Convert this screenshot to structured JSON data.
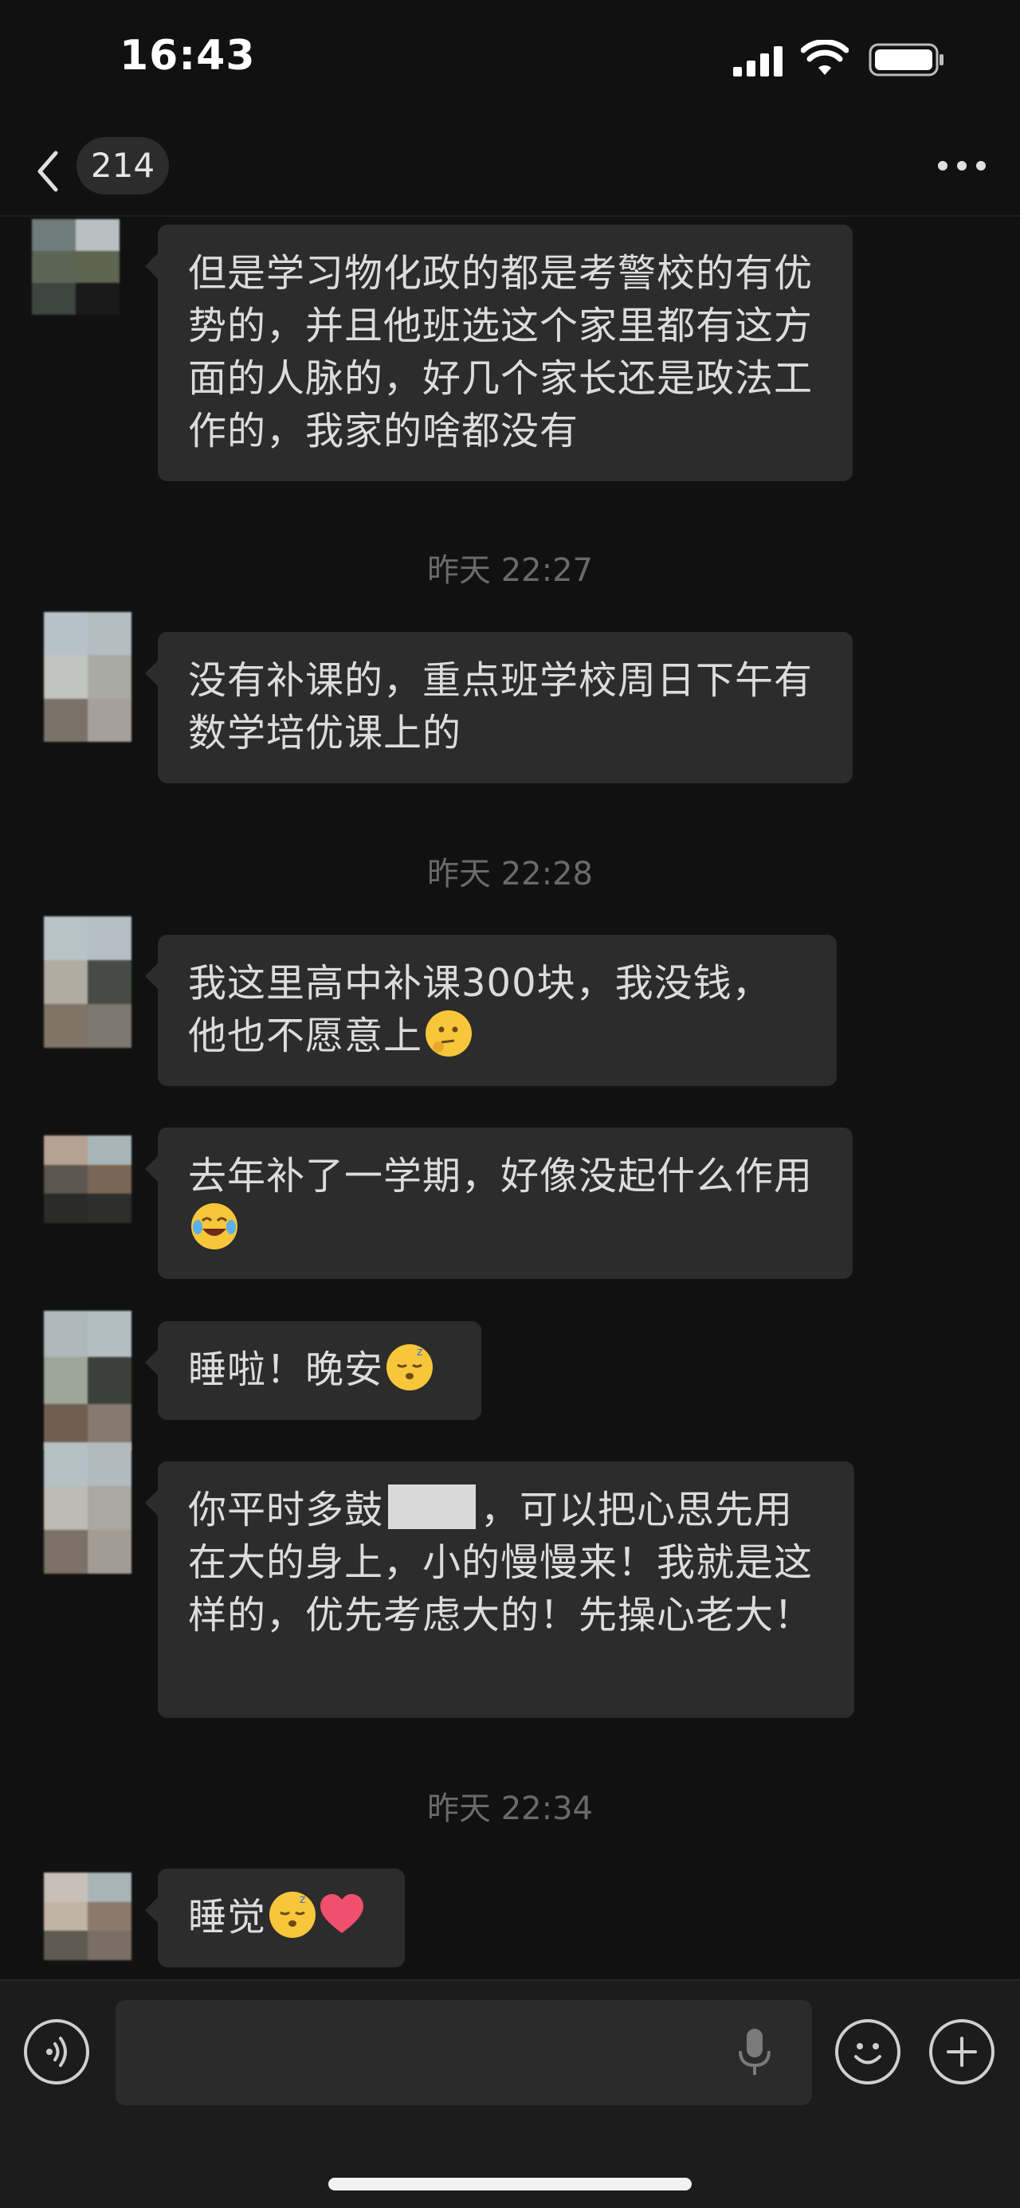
{
  "status_bar": {
    "time": "16:43",
    "signal": "signal-bars-icon",
    "wifi": "wifi-icon",
    "battery": "battery-icon"
  },
  "nav": {
    "unread_count": "214",
    "back_icon": "chevron-left-icon",
    "more_icon": "more-dots-icon"
  },
  "messages": [
    {
      "text": "但是学习物化政的都是考警校的有优势的，并且他班选这个家里都有这方面的人脉的，好几个家长还是政法工作的，我家的啥都没有"
    },
    {
      "timestamp": "昨天 22:27"
    },
    {
      "text": "没有补课的，重点班学校周日下午有数学培优课上的"
    },
    {
      "timestamp": "昨天 22:28"
    },
    {
      "text": "我这里高中补课300块，我没钱，他也不愿意上",
      "emoji": "thinking-face-emoji"
    },
    {
      "text": "去年补了一学期，好像没起什么作用",
      "emoji": "tears-of-joy-emoji"
    },
    {
      "text": "睡啦！晚安",
      "emoji": "sleeping-face-emoji"
    },
    {
      "text_a": "你平时多鼓",
      "text_b": "，可以把心思先用在大的身上，小的慢慢来！我就是这样的，优先考虑大的！先操心老大！"
    },
    {
      "timestamp": "昨天 22:34"
    },
    {
      "text": "睡觉",
      "emoji": "sleeping-face-emoji",
      "emoji2": "red-heart-emoji"
    }
  ],
  "input_bar": {
    "voice": "voice-icon",
    "mic": "microphone-icon",
    "emoji": "smiley-icon",
    "plus": "plus-icon",
    "placeholder": ""
  },
  "colors": {
    "background": "#111111",
    "bubble": "#2c2c2c",
    "text": "#dcdcdc",
    "timestamp": "#6a6a6a"
  }
}
